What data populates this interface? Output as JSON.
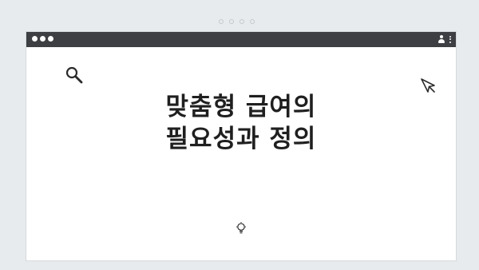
{
  "headline": {
    "line1": "맞춤형 급여의",
    "line2": "필요성과 정의"
  },
  "icons": {
    "search": "search-icon",
    "cursor": "cursor-arrow-icon",
    "lightbulb": "lightbulb-icon",
    "profile": "profile-icon",
    "menu": "kebab-menu-icon"
  },
  "colors": {
    "titlebar": "#3d3f42",
    "background": "#e8ebee",
    "window": "#ffffff",
    "text": "#1f1f1f"
  }
}
